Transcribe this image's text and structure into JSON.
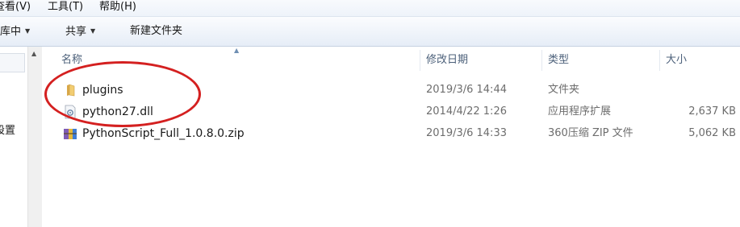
{
  "menubar": {
    "items": [
      {
        "label": "查看(V)"
      },
      {
        "label": "工具(T)"
      },
      {
        "label": "帮助(H)"
      }
    ]
  },
  "toolbar": {
    "include_in_library": "库中",
    "share": "共享",
    "new_folder": "新建文件夹"
  },
  "navpane": {
    "visible_text": "設置"
  },
  "columns": {
    "name": "名称",
    "date": "修改日期",
    "type": "类型",
    "size": "大小"
  },
  "files": [
    {
      "name": "plugins",
      "date": "2019/3/6 14:44",
      "type": "文件夹",
      "size": "",
      "icon": "folder-icon"
    },
    {
      "name": "python27.dll",
      "date": "2014/4/22 1:26",
      "type": "应用程序扩展",
      "size": "2,637 KB",
      "icon": "dll-file-icon"
    },
    {
      "name": "PythonScript_Full_1.0.8.0.zip",
      "date": "2019/3/6 14:33",
      "type": "360压缩 ZIP 文件",
      "size": "5,062 KB",
      "icon": "zip-archive-icon"
    }
  ],
  "annotation": {
    "shape": "ellipse",
    "color": "#d42020"
  }
}
